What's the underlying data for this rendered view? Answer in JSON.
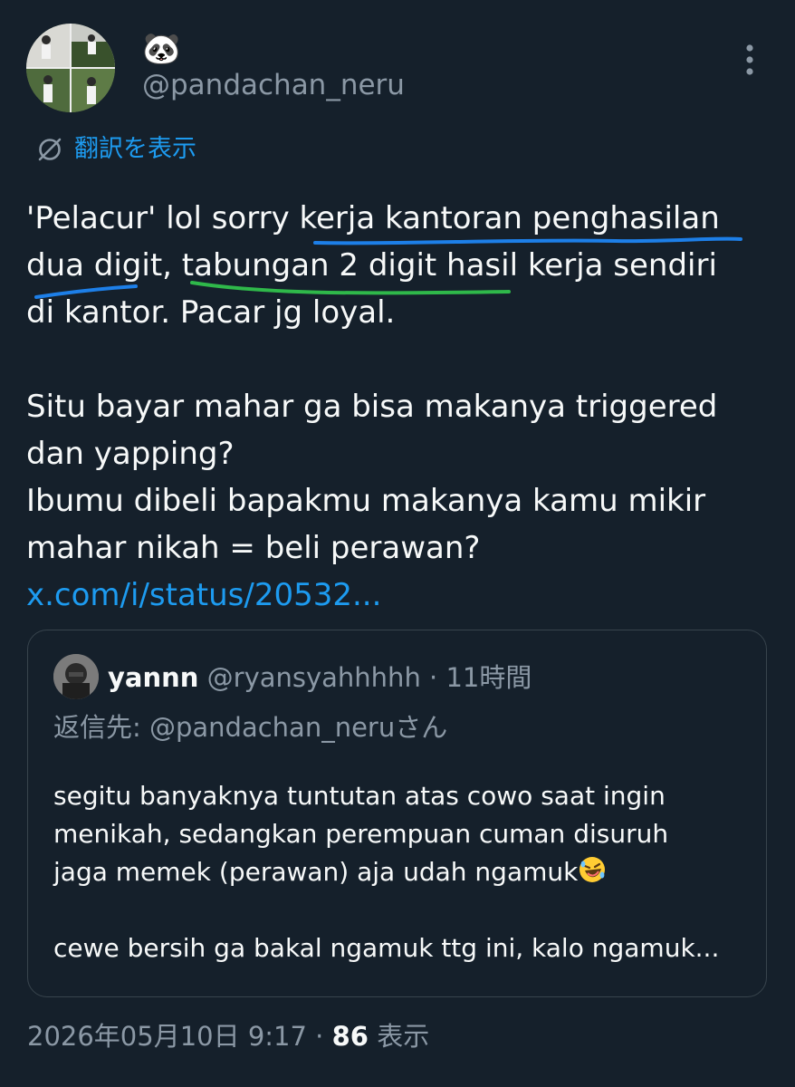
{
  "author": {
    "display_name": "🐼",
    "handle": "@pandachan_neru"
  },
  "translate": {
    "label": "翻訳を表示"
  },
  "tweet": {
    "lines": [
      "'Pelacur' lol sorry kerja kantoran penghasilan",
      "dua digit, tabungan 2 digit hasil kerja sendiri",
      "di kantor. Pacar jg loyal.",
      "Situ bayar mahar ga bisa makanya triggered",
      "dan yapping?",
      "Ibumu dibeli bapakmu makanya kamu mikir",
      "mahar nikah = beli perawan?"
    ],
    "link": "x.com/i/status/20532..."
  },
  "quoted": {
    "name": "yannn",
    "handle": "@ryansyahhhhh",
    "dot": "·",
    "time": "11時間",
    "reply_to": "返信先: @pandachan_neruさん",
    "lines": [
      "segitu banyaknya tuntutan atas cowo saat ingin",
      "menikah, sedangkan perempuan cuman disuruh",
      "jaga memek (perawan) aja udah ngamuk"
    ],
    "last_line": "cewe bersih ga bakal ngamuk ttg ini, kalo ngamuk..."
  },
  "meta": {
    "timestamp": "2026年05月10日 9:17",
    "separator": "·",
    "views": "86",
    "views_label": "表示"
  },
  "icons": {
    "more": "more-vertical-icon",
    "translate": "translate-globe-icon",
    "emoji": "rolling-on-floor-laughing-emoji"
  },
  "colors": {
    "background": "#15202b",
    "text": "#f7f9f9",
    "secondary": "#8b98a5",
    "link": "#1d9bf0",
    "border": "#38444d",
    "blue_underline": "#1d7fe8",
    "green_underline": "#2fb84a"
  }
}
